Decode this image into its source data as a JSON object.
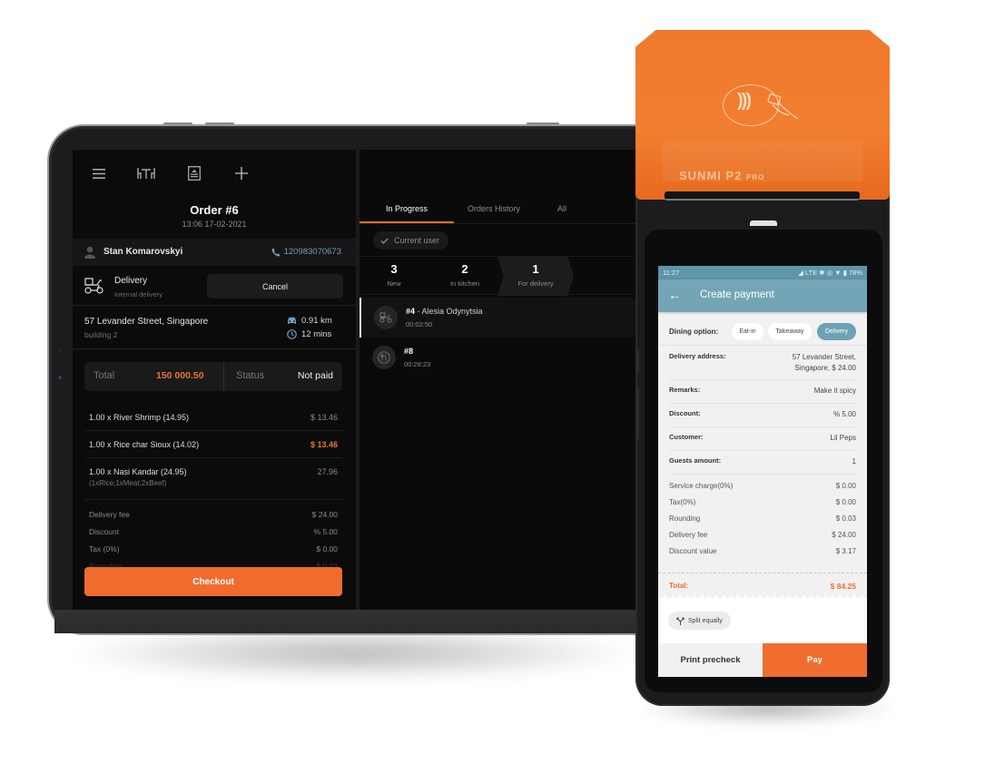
{
  "tablet": {
    "toolbar": {
      "icons": [
        "menu-icon",
        "tables-icon",
        "receipt-icon",
        "add-icon"
      ]
    },
    "order": {
      "title": "Order #6",
      "datetime": "13:06 17-02-2021"
    },
    "customer": {
      "name": "Stan Komarovskyi",
      "phone": "120983070673"
    },
    "delivery": {
      "title": "Delivery",
      "subtitle": "Internal delivery",
      "cancel_label": "Cancel"
    },
    "address": {
      "line1": "57 Levander Street, Singapore",
      "line2": "building 2",
      "distance": "0.91 km",
      "eta": "12 mins"
    },
    "totals": {
      "total_label": "Total",
      "total_value": "150 000.50",
      "status_label": "Status",
      "status_value": "Not paid"
    },
    "items": [
      {
        "name": "1.00 x River Shrimp (14.95)",
        "modifiers": "",
        "price": "$ 13.46",
        "highlight": false
      },
      {
        "name": "1.00  x Rice char Sioux (14.02)",
        "modifiers": "",
        "price": "$ 13.46",
        "highlight": true
      },
      {
        "name": "1.00 x Nasi Kandar (24.95)",
        "modifiers": "(1xRice;1xMeat;2xBeef)",
        "price": "27.96",
        "highlight": false
      }
    ],
    "summary": [
      {
        "label": "Delivery fee",
        "value": "$ 24.00"
      },
      {
        "label": "Discount",
        "value": "% 5.00"
      },
      {
        "label": "Tax (0%)",
        "value": "$ 0.00"
      },
      {
        "label": "Rounding",
        "value": "$ 0.03"
      }
    ],
    "checkout_label": "Checkout",
    "right": {
      "tabs": [
        {
          "label": "In Progress",
          "active": true
        },
        {
          "label": "Orders History",
          "active": false
        },
        {
          "label": "All",
          "active": false
        }
      ],
      "filter_chip": "Current user",
      "steps": [
        {
          "count": "3",
          "label": "New"
        },
        {
          "count": "2",
          "label": "In kitchen"
        },
        {
          "count": "1",
          "label": "For delivery"
        }
      ],
      "orders": [
        {
          "number": "#4",
          "name": " - Alesia Odynytsia",
          "time": "00:02:50",
          "icon": "delivery-scooter-icon"
        },
        {
          "number": "#8",
          "name": "",
          "time": "00:28:23",
          "icon": "fork-knife-icon"
        }
      ]
    }
  },
  "pos": {
    "brand": "SUNMI P2",
    "brand_suffix": "PRO",
    "statusbar": {
      "time": "11:27",
      "icons": "◢ LTE ✱ ◎ ▼ ▮ 78%"
    },
    "title": "Create payment",
    "dining": {
      "label": "Dining option:",
      "options": [
        {
          "label": "Eat-in",
          "selected": false
        },
        {
          "label": "Takeaway",
          "selected": false
        },
        {
          "label": "Delivery",
          "selected": true
        }
      ]
    },
    "details": [
      {
        "label": "Delivery address:",
        "value_line1": "57 Levander Street,",
        "value_line2": "Singapore, $ 24.00"
      },
      {
        "label": "Remarks:",
        "value_line1": "Make it spicy",
        "value_line2": ""
      },
      {
        "label": "Discount:",
        "value_line1": "% 5.00",
        "value_line2": ""
      },
      {
        "label": "Customer:",
        "value_line1": "Lil Peps",
        "value_line2": ""
      },
      {
        "label": "Guests amount:",
        "value_line1": "1",
        "value_line2": ""
      }
    ],
    "calc": [
      {
        "label": "Service charge(0%)",
        "value": "$ 0.00"
      },
      {
        "label": "Tax(0%)",
        "value": "$ 0.00"
      },
      {
        "label": "Rounding",
        "value": "$ 0.03"
      },
      {
        "label": "Delivery fee",
        "value": "$ 24.00"
      },
      {
        "label": "Discount value",
        "value": "$ 3.17"
      }
    ],
    "total_label": "Total:",
    "total_value": "$ 84.25",
    "split_label": "Split equally",
    "print_label": "Print precheck",
    "pay_label": "Pay"
  },
  "colors": {
    "accent": "#ef6c2e",
    "pos_header": "#74a5b6",
    "link": "#6d9ec0"
  }
}
